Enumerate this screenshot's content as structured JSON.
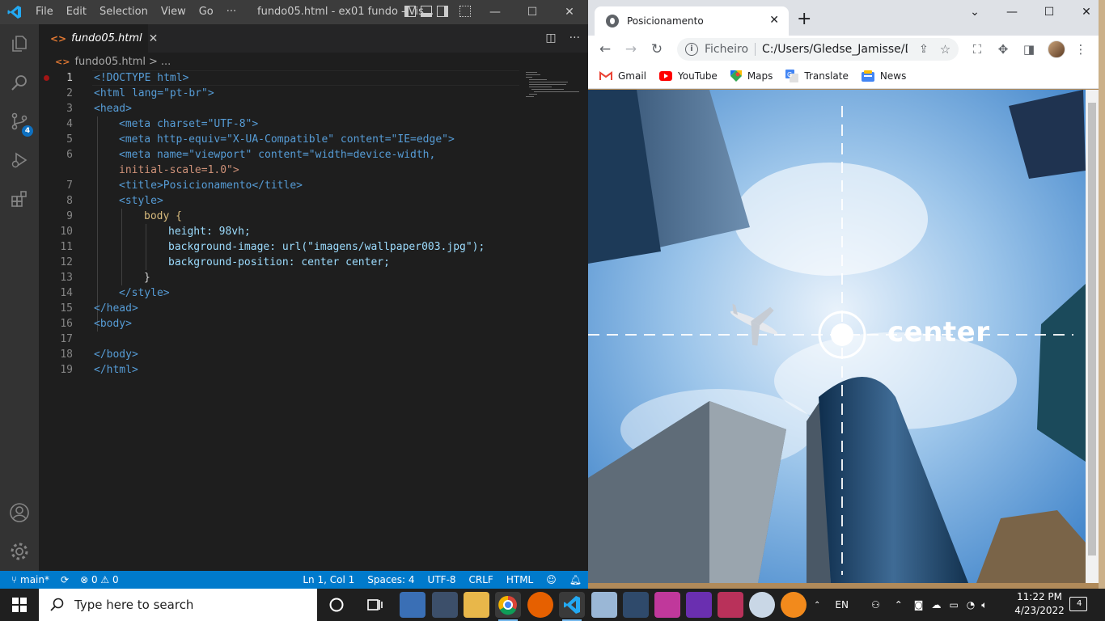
{
  "vscode": {
    "window_title": "fundo05.html - ex01 fundo - Vis...",
    "menu": [
      "File",
      "Edit",
      "Selection",
      "View",
      "Go",
      "···"
    ],
    "tab": {
      "label": "fundo05.html",
      "close": "✕"
    },
    "breadcrumb": {
      "file": "fundo05.html",
      "sep": ">",
      "rest": "..."
    },
    "line_numbers": [
      "1",
      "2",
      "3",
      "4",
      "5",
      "6",
      "",
      "7",
      "8",
      "9",
      "10",
      "11",
      "12",
      "13",
      "14",
      "15",
      "16",
      "17",
      "18",
      "19"
    ],
    "badge_count": "4",
    "status": {
      "branch": "main*",
      "errors": "0",
      "warnings": "0",
      "position": "Ln 1, Col 1",
      "spaces": "Spaces: 4",
      "encoding": "UTF-8",
      "eol": "CRLF",
      "language": "HTML"
    },
    "code": {
      "l1": "<!DOCTYPE html>",
      "l2": "<html lang=\"pt-br\">",
      "l3": "<head>",
      "l4": "<meta charset=\"UTF-8\">",
      "l5": "<meta http-equiv=\"X-UA-Compatible\" content=\"IE=edge\">",
      "l6a": "<meta name=\"viewport\" content=\"width=device-width,",
      "l6b": "initial-scale=1.0\">",
      "l7": "<title>Posicionamento</title>",
      "l8": "<style>",
      "l9": "body {",
      "l10": "height: 98vh;",
      "l11": "background-image: url(\"imagens/wallpaper003.jpg\");",
      "l12": "background-position: center center;",
      "l13": "}",
      "l14": "</style>",
      "l15": "</head>",
      "l16": "<body>",
      "l18": "</body>",
      "l19": "</html>"
    }
  },
  "chrome": {
    "tab_title": "Posicionamento",
    "address_chip": "Ficheiro",
    "url": "C:/Users/Gledse_Jamisse/D...",
    "bookmarks": [
      "Gmail",
      "YouTube",
      "Maps",
      "Translate",
      "News"
    ],
    "page_text": "center",
    "colors": {
      "sky": "#5b9ad6",
      "accent": "#1a73e8"
    }
  },
  "taskbar": {
    "search_placeholder": "Type here to search",
    "lang": "EN",
    "time": "11:22 PM",
    "date": "4/23/2022",
    "notifications": "4"
  }
}
